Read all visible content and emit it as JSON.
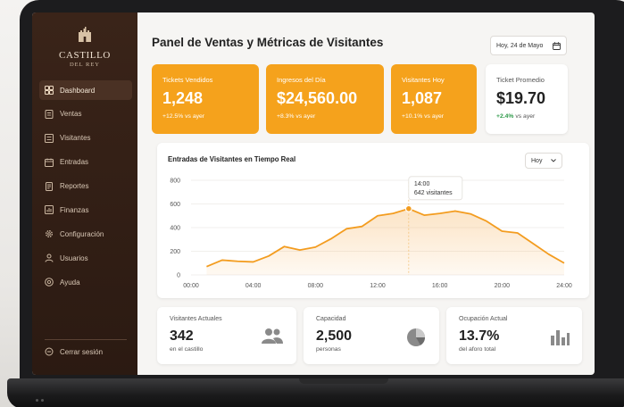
{
  "brand": {
    "name": "CASTILLO",
    "sub": "DEL REY"
  },
  "sidebar": {
    "items": [
      {
        "label": "Dashboard",
        "icon": "grid-icon"
      },
      {
        "label": "Ventas",
        "icon": "receipt-icon"
      },
      {
        "label": "Visitantes",
        "icon": "users-icon"
      },
      {
        "label": "Entradas",
        "icon": "ticket-icon"
      },
      {
        "label": "Reportes",
        "icon": "report-icon"
      },
      {
        "label": "Finanzas",
        "icon": "finance-icon"
      },
      {
        "label": "Configuración",
        "icon": "gear-icon"
      },
      {
        "label": "Usuarios",
        "icon": "user-icon"
      },
      {
        "label": "Ayuda",
        "icon": "help-icon"
      }
    ],
    "active": "Dashboard",
    "logout_label": "Cerrar sesión"
  },
  "header": {
    "title": "Panel de Ventas y Métricas de Visitantes",
    "date_label": "Hoy, 24 de Mayo"
  },
  "kpis": [
    {
      "label": "Tickets Vendidos",
      "value": "1,248",
      "sub": "+12.5% vs ayer"
    },
    {
      "label": "Ingresos del Día",
      "value": "$24,560.00",
      "sub": "+8.3% vs ayer"
    },
    {
      "label": "Visitantes Hoy",
      "value": "1,087",
      "sub": "+10.1% vs ayer"
    },
    {
      "label": "Ticket Promedio",
      "value": "$19.70",
      "sub_change": "+2.4%",
      "sub_rest": " vs ayer"
    }
  ],
  "chart_panel": {
    "title": "Entradas de Visitantes en Tiempo Real",
    "range": "Hoy",
    "tooltip": {
      "time": "14:00",
      "value": "642 visitantes"
    }
  },
  "chart_data": {
    "type": "area",
    "x": [
      "01:00",
      "02:00",
      "03:00",
      "04:00",
      "05:00",
      "06:00",
      "07:00",
      "08:00",
      "09:00",
      "10:00",
      "11:00",
      "12:00",
      "13:00",
      "14:00",
      "15:00",
      "16:00",
      "17:00",
      "18:00",
      "19:00",
      "20:00",
      "21:00",
      "22:00",
      "23:00",
      "24:00"
    ],
    "series": [
      {
        "values": [
          70,
          125,
          115,
          110,
          160,
          240,
          210,
          235,
          305,
          390,
          410,
          500,
          520,
          560,
          505,
          520,
          540,
          515,
          455,
          370,
          355,
          265,
          175,
          100
        ]
      }
    ],
    "xticks": [
      "00:00",
      "04:00",
      "08:00",
      "12:00",
      "16:00",
      "20:00",
      "24:00"
    ],
    "yticks": [
      "0",
      "200",
      "400",
      "600",
      "800"
    ],
    "ylim": [
      0,
      800
    ],
    "xlim": [
      0,
      24
    ],
    "highlight": {
      "x": 14,
      "y": 560
    },
    "grid": true,
    "colors": {
      "line": "#f39c1f",
      "fill": "#f6b15a"
    }
  },
  "stats": [
    {
      "label": "Visitantes Actuales",
      "value": "342",
      "sub": "en el castillo",
      "icon": "people-icon"
    },
    {
      "label": "Capacidad",
      "value": "2,500",
      "sub": "personas",
      "icon": "pie-chart-icon"
    },
    {
      "label": "Ocupación Actual",
      "value": "13.7%",
      "sub": "del aforo total",
      "icon": "bar-chart-icon"
    }
  ],
  "colors": {
    "accent": "#f5a21c",
    "sidebar": "#2f1d14",
    "positive": "#2f9a4a"
  }
}
